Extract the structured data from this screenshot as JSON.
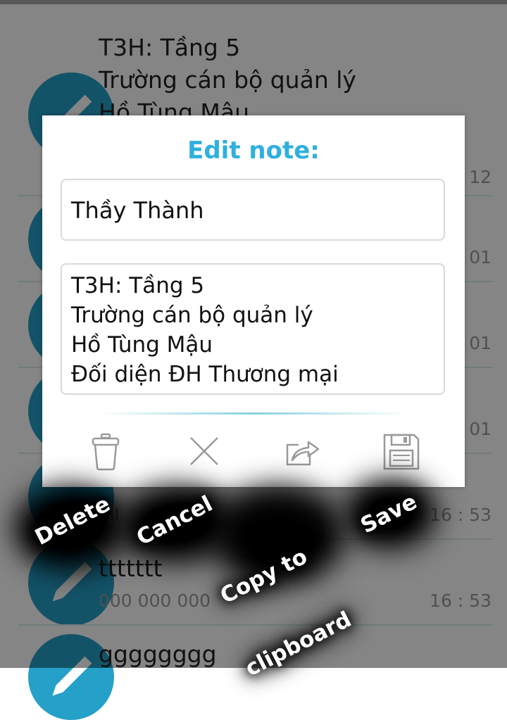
{
  "notes": [
    {
      "title_lines": [
        "T3H: Tầng 5",
        "Trường cán bộ quản lý",
        "Hồ Tùng Mậu"
      ],
      "sub": "",
      "time": "12"
    },
    {
      "title_lines": [],
      "sub": "",
      "time": "01"
    },
    {
      "title_lines": [],
      "sub": "",
      "time": "01"
    },
    {
      "title_lines": [],
      "sub": "",
      "time": "01"
    },
    {
      "title_lines": [],
      "sub": "ull",
      "time": "16 : 53"
    },
    {
      "title_lines": [
        "ttttttt"
      ],
      "sub": "000 000 000",
      "time": "16 : 53"
    },
    {
      "title_lines": [
        "gggggggg"
      ],
      "sub": "",
      "time": ""
    }
  ],
  "dialog": {
    "title": "Edit note:",
    "note_title_value": "Thầy Thành",
    "note_body_lines": [
      "T3H: Tầng 5",
      "Trường cán bộ quản lý",
      "Hồ Tùng Mậu",
      "Đối diện ĐH Thương mại"
    ],
    "actions": [
      {
        "name": "delete",
        "icon": "trash-icon"
      },
      {
        "name": "cancel",
        "icon": "close-icon"
      },
      {
        "name": "copy",
        "icon": "share-icon"
      },
      {
        "name": "save",
        "icon": "floppy-disk-icon"
      }
    ]
  },
  "hints": {
    "delete": "Delete",
    "cancel": "Cancel",
    "copy_line1": "Copy to",
    "copy_line2": "clipboard",
    "save": "Save"
  },
  "colors": {
    "accent": "#2fb0de",
    "avatar": "#25a0c8"
  }
}
